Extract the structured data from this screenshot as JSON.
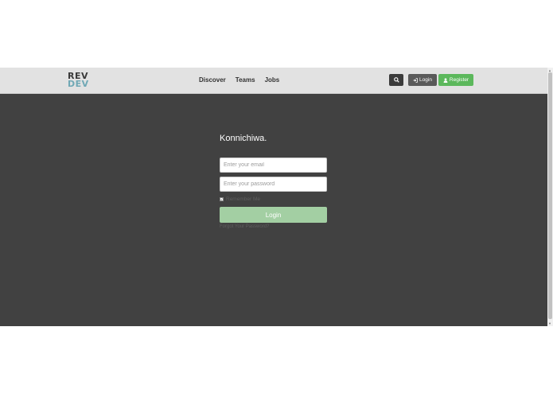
{
  "brand": {
    "line1": "REV",
    "line2": "DEV"
  },
  "nav": {
    "links": [
      "Discover",
      "Teams",
      "Jobs"
    ]
  },
  "header_buttons": {
    "login": "Login",
    "register": "Register"
  },
  "login_form": {
    "greeting": "Konnichiwa.",
    "email_placeholder": "Enter your email",
    "password_placeholder": "Enter your password",
    "remember_label": "Remember Me",
    "remember_checked": true,
    "submit_label": "Login",
    "forgot_link": "Forgot Your Password?"
  },
  "colors": {
    "navbar": "#e2e2e2",
    "background": "#414141",
    "register": "#5cb85c",
    "submit": "#a3cfa3"
  },
  "icons": {
    "search": "search-icon",
    "login": "sign-in-icon",
    "register": "user-icon"
  }
}
